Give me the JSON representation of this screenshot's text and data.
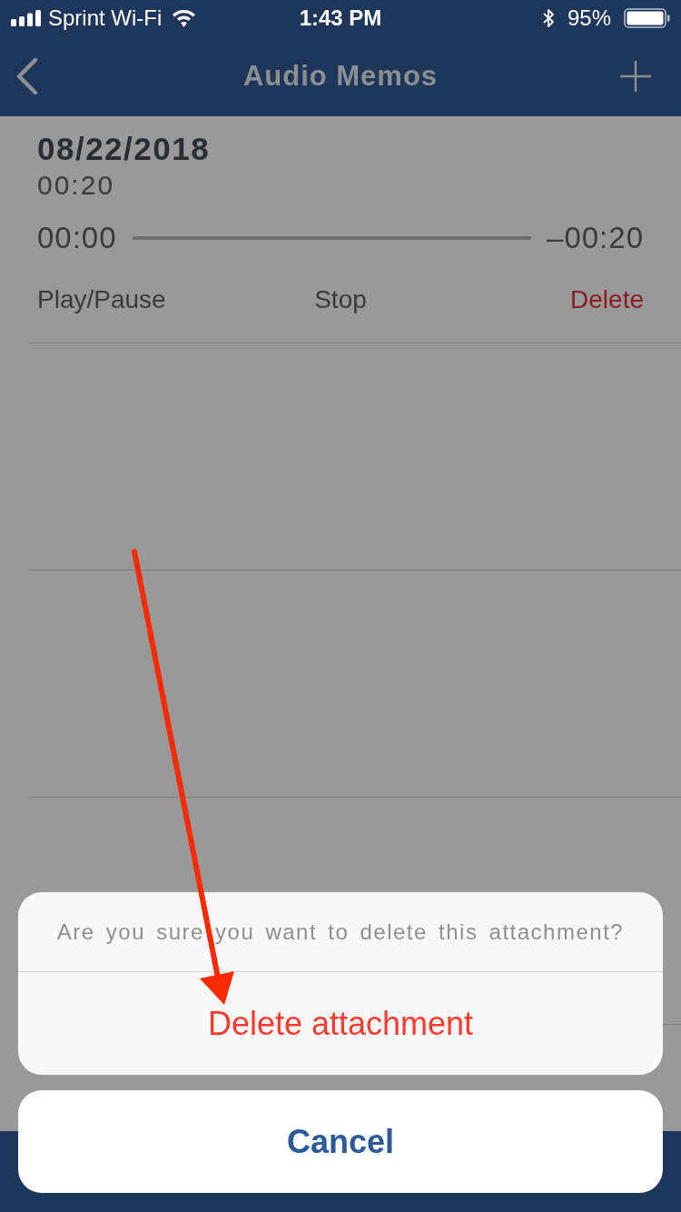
{
  "status_bar": {
    "carrier": "Sprint Wi-Fi",
    "time": "1:43 PM",
    "battery": "95%"
  },
  "nav_bar": {
    "title": "Audio Memos"
  },
  "memos": [
    {
      "date": "08/22/2018",
      "duration": "00:20",
      "elapsed": "00:00",
      "remaining": "–00:20",
      "actions": [
        {
          "label": "Play/Pause",
          "kind": "normal"
        },
        {
          "label": "Stop",
          "kind": "normal"
        },
        {
          "label": "Delete",
          "kind": "destructive"
        }
      ]
    }
  ],
  "action_sheet": {
    "message": "Are you sure you want to delete this attachment?",
    "actions": [
      {
        "label": "Delete attachment",
        "kind": "destructive"
      }
    ],
    "cancel": "Cancel"
  }
}
